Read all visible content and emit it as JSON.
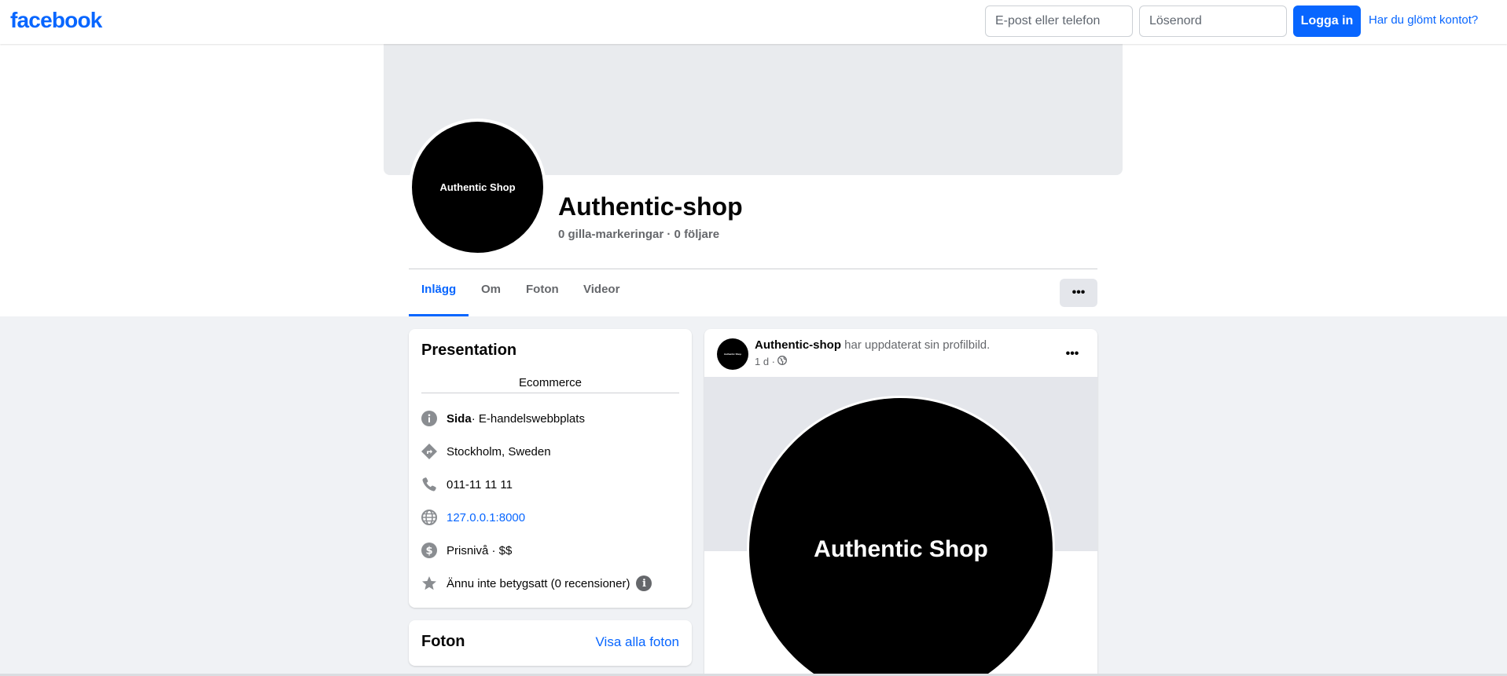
{
  "nav": {
    "logo": "facebook",
    "email_placeholder": "E-post eller telefon",
    "password_placeholder": "Lösenord",
    "login_label": "Logga in",
    "forgot_label": "Har du glömt kontot?"
  },
  "profile": {
    "avatar_text": "Authentic Shop",
    "name": "Authentic-shop",
    "stats": "0 gilla-markeringar · 0 följare"
  },
  "tabs": [
    {
      "label": "Inlägg",
      "active": true
    },
    {
      "label": "Om",
      "active": false
    },
    {
      "label": "Foton",
      "active": false
    },
    {
      "label": "Videor",
      "active": false
    }
  ],
  "more_label": "•••",
  "intro": {
    "title": "Presentation",
    "bio": "Ecommerce",
    "page_type_bold": "Sida",
    "page_type_rest": " · E-handelswebbplats",
    "location": "Stockholm, Sweden",
    "phone": "011-11 11 11",
    "website": "127.0.0.1:8000",
    "price": "Prisnivå · $$",
    "rating": "Ännu inte betygsatt (0 recensioner)"
  },
  "photos": {
    "title": "Foton",
    "see_all": "Visa alla foton"
  },
  "post": {
    "author": "Authentic-shop",
    "action": " har uppdaterat sin profilbild.",
    "time": "1 d ·",
    "avatar_text": "Authentic Shop",
    "image_text": "Authentic Shop",
    "more_label": "•••"
  },
  "colors": {
    "brand": "#0866ff",
    "secondary_text": "#65676b",
    "background": "#f0f2f5"
  }
}
